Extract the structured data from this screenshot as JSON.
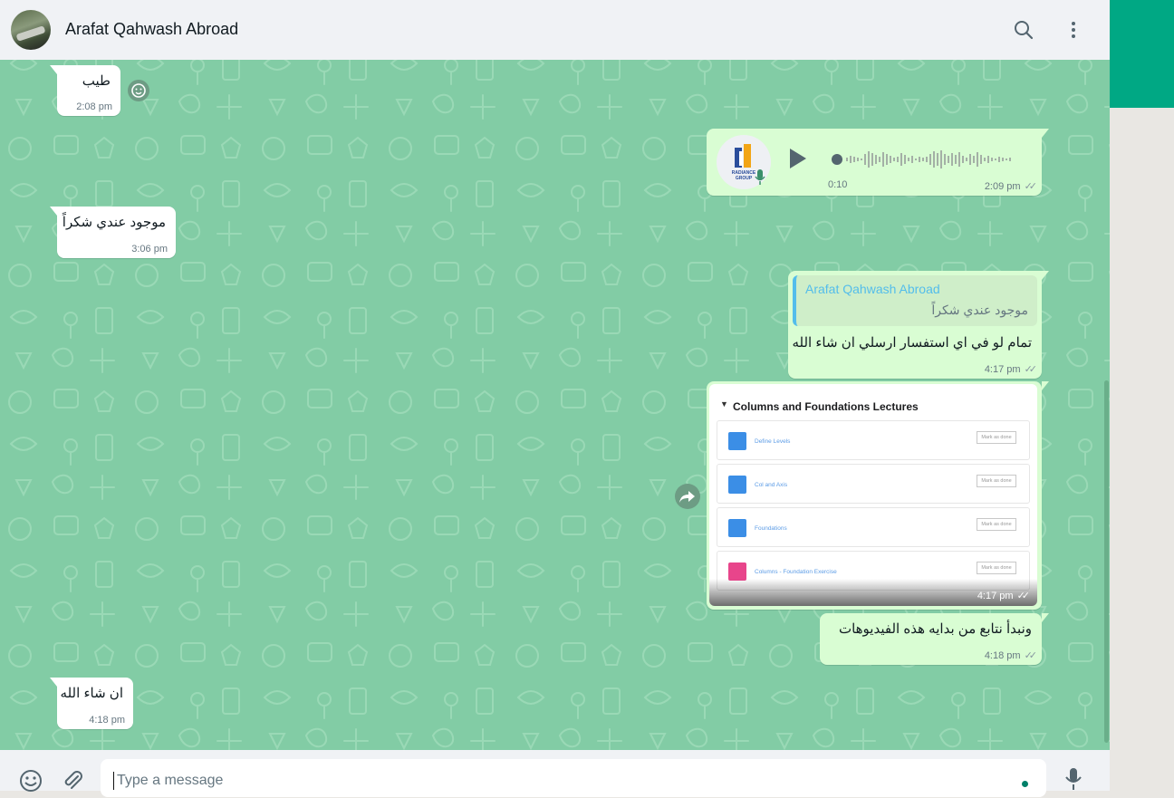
{
  "header": {
    "contact_name": "Arafat Qahwash Abroad"
  },
  "messages": {
    "m1": {
      "text": "طيب",
      "time": "2:08 pm"
    },
    "voice": {
      "duration": "0:10",
      "time": "2:09 pm",
      "avatar_text": "RADIANCE GROUP"
    },
    "m2": {
      "text": "موجود عندي شكراً",
      "time": "3:06 pm"
    },
    "reply": {
      "quote_name": "Arafat Qahwash Abroad",
      "quote_text": "موجود عندي شكراً",
      "text": "تمام لو في اي استفسار ارسلي ان شاء الله",
      "time": "4:17 pm"
    },
    "image": {
      "title": "Columns and Foundations Lectures",
      "mark_label": "Mark as done",
      "lectures": [
        "Define Levels",
        "Col and Axis",
        "Foundations",
        "Columns - Foundation Exercise"
      ],
      "time": "4:17 pm"
    },
    "m3": {
      "text": "ونبدأ نتابع من بدايه هذه الفيديوهات",
      "time": "4:18 pm"
    },
    "m4": {
      "text": "ان شاء الله",
      "time": "4:18 pm"
    }
  },
  "composer": {
    "placeholder": "Type a message"
  },
  "colors": {
    "chat_bg": "#82cca5",
    "outgoing": "#d9fdd3",
    "incoming": "#ffffff",
    "accent": "#00a884",
    "link": "#53bdeb"
  },
  "icons": [
    "search-icon",
    "menu-icon",
    "emoji-icon",
    "attach-icon",
    "mic-icon",
    "play-icon",
    "forward-icon",
    "reaction-icon",
    "read-ticks-icon"
  ]
}
